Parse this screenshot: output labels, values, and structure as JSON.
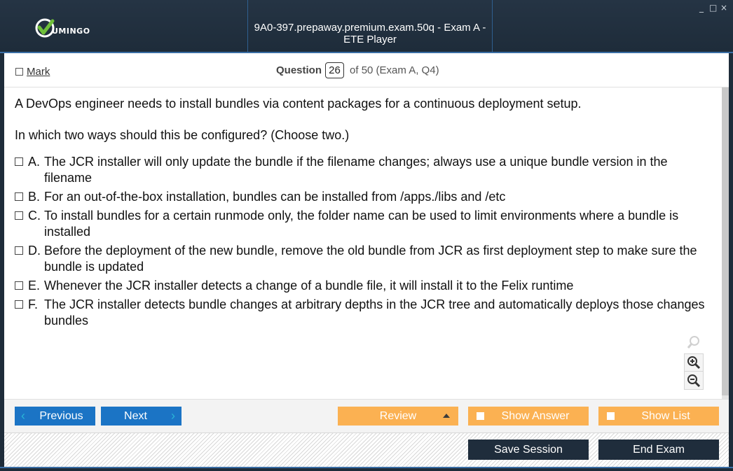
{
  "window": {
    "title": "9A0-397.prepaway.premium.exam.50q - Exam A - ETE Player",
    "controls": [
      "_",
      "□",
      "×"
    ]
  },
  "logo": {
    "text": "UMINGO",
    "icon": "vumingo-check-logo",
    "accent": "#6fbf3a"
  },
  "header": {
    "mark_label": "Mark",
    "question_label": "Question",
    "question_number": "26",
    "question_of": "of 50 (Exam A, Q4)"
  },
  "question": {
    "paragraphs": [
      "A DevOps engineer needs to install bundles via content packages for a continuous deployment setup.",
      "In which two ways should this be configured? (Choose two.)"
    ],
    "options": [
      {
        "letter": "A.",
        "text": "The JCR installer will only update the bundle if the filename changes; always use a unique bundle version in the filename"
      },
      {
        "letter": "B.",
        "text": "For an out-of-the-box installation, bundles can be installed from /apps./libs and /etc"
      },
      {
        "letter": "C.",
        "text": "To install bundles for a certain runmode only, the folder name can be used to limit environments where a bundle is installed"
      },
      {
        "letter": "D.",
        "text": "Before the deployment of the new bundle, remove the old bundle from JCR as first deployment step to make sure the bundle is updated"
      },
      {
        "letter": "E.",
        "text": "Whenever the JCR installer detects a change of a bundle file, it will install it to the Felix runtime"
      },
      {
        "letter": "F.",
        "text": "The JCR installer detects bundle changes at arbitrary depths in the JCR tree and automatically deploys those changes bundles"
      }
    ]
  },
  "zoom": {
    "icons": [
      "search-faint-icon",
      "zoom-in-icon",
      "zoom-out-icon"
    ]
  },
  "nav": {
    "previous_label": "Previous",
    "next_label": "Next",
    "review_label": "Review",
    "show_answer_label": "Show Answer",
    "show_list_label": "Show List"
  },
  "bottom": {
    "save_label": "Save Session",
    "end_label": "End Exam"
  },
  "colors": {
    "titlebar": "#1e2c3a",
    "blue_button": "#1b74c5",
    "orange_button": "#fbb152",
    "dark_button": "#1f2d3c"
  }
}
